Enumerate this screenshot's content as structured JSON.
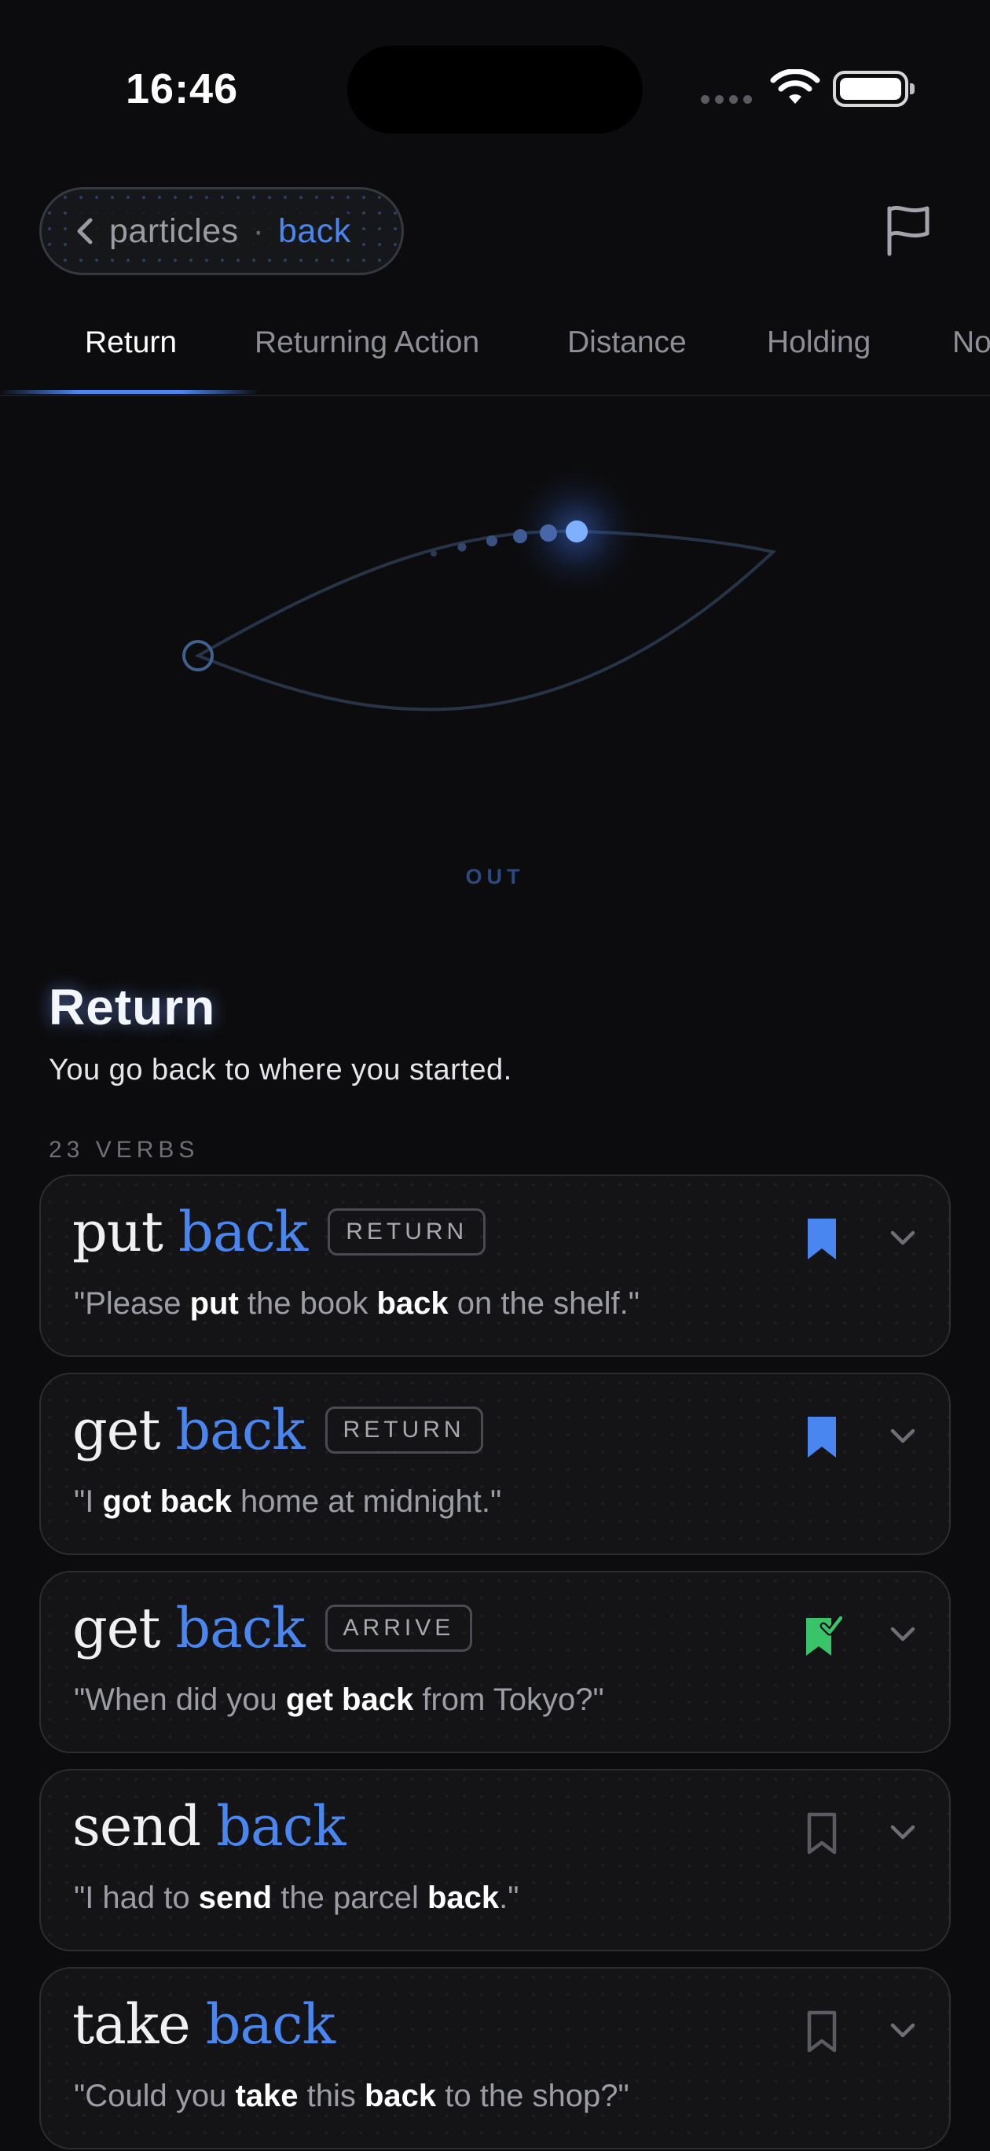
{
  "status_bar": {
    "time": "16:46"
  },
  "nav": {
    "breadcrumb_parent": "particles",
    "breadcrumb_separator": "·",
    "breadcrumb_current": "back"
  },
  "tabs": [
    {
      "label": "Return",
      "active": true
    },
    {
      "label": "Returning Action",
      "active": false
    },
    {
      "label": "Distance",
      "active": false
    },
    {
      "label": "Holding",
      "active": false
    },
    {
      "label": "No",
      "active": false
    }
  ],
  "diagram": {
    "label": "OUT"
  },
  "sense": {
    "title": "Return",
    "description": "You go back to where you started.",
    "verb_count": "23 VERBS"
  },
  "colors": {
    "accent": "#4a86f0",
    "saved_green": "#39c46a",
    "background": "#0c0c0e"
  },
  "verbs": [
    {
      "verb": "put",
      "particle": "back",
      "tag": "RETURN",
      "bookmark": "filled",
      "example_parts": [
        "\"Please ",
        "put",
        " the book ",
        "back",
        " on the shelf.\""
      ]
    },
    {
      "verb": "get",
      "particle": "back",
      "tag": "RETURN",
      "bookmark": "filled",
      "example_parts": [
        "\"I ",
        "got back",
        " home at midnight.\""
      ]
    },
    {
      "verb": "get",
      "particle": "back",
      "tag": "ARRIVE",
      "bookmark": "checked",
      "example_parts": [
        "\"When did you ",
        "get back",
        " from Tokyo?\""
      ]
    },
    {
      "verb": "send",
      "particle": "back",
      "tag": "",
      "bookmark": "outline",
      "example_parts": [
        "\"I had to ",
        "send",
        " the parcel ",
        "back",
        ".\""
      ]
    },
    {
      "verb": "take",
      "particle": "back",
      "tag": "",
      "bookmark": "outline",
      "example_parts": [
        "\"Could you ",
        "take",
        " this ",
        "back",
        " to the shop?\""
      ]
    }
  ]
}
